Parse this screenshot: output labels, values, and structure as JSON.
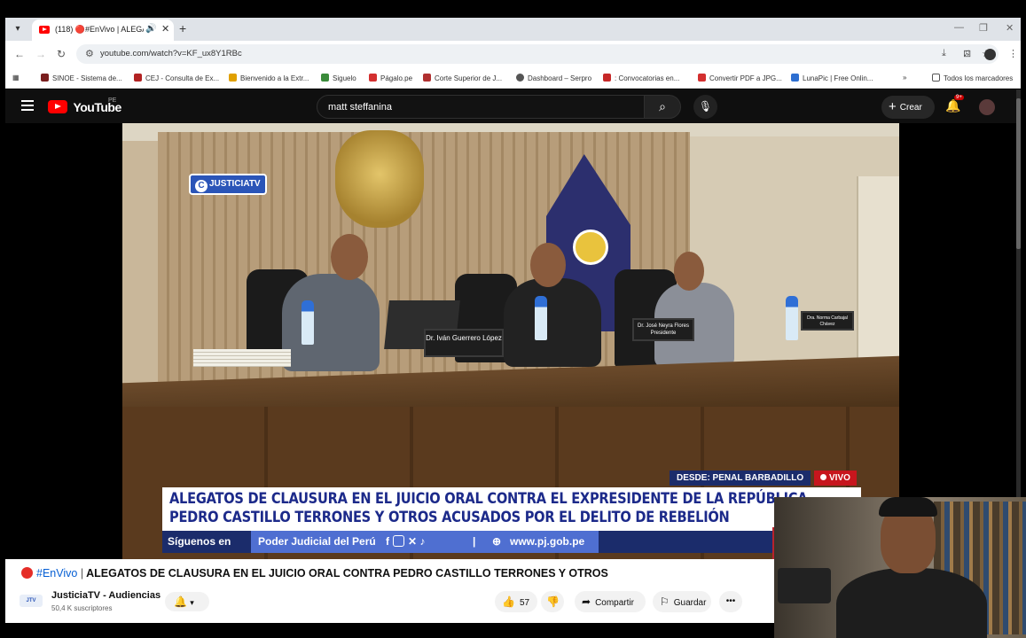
{
  "browser": {
    "tab_title": "(118) 🔴#EnVivo | ALEGATO",
    "url": "youtube.com/watch?v=KF_ux8Y1RBc",
    "bookmarks": [
      {
        "label": "SINOE - Sistema de...",
        "color": "#7a1f1f"
      },
      {
        "label": "CEJ - Consulta de Ex...",
        "color": "#b22222"
      },
      {
        "label": "Bienvenido a la Extr...",
        "color": "#e0a000"
      },
      {
        "label": "Siguelo",
        "color": "#3b8b3b"
      },
      {
        "label": "Págalo.pe",
        "color": "#d32f2f"
      },
      {
        "label": "Corte Superior de J...",
        "color": "#b03030"
      },
      {
        "label": "Dashboard – Serpro",
        "color": "#555555"
      },
      {
        "label": ": Convocatorias en...",
        "color": "#c62828"
      },
      {
        "label": "Convertir PDF a JPG...",
        "color": "#d32f2f"
      },
      {
        "label": "LunaPic | Free Onlin...",
        "color": "#2e6fd1"
      }
    ],
    "all_bookmarks": "Todos los marcadores"
  },
  "youtube": {
    "logo_text": "YouTube",
    "region": "PE",
    "search_value": "matt steffanina",
    "create_label": "Crear",
    "notif_badge": "9+"
  },
  "video": {
    "channel_bug": "JUSTICIATV",
    "nameplates": [
      "Dr. Iván Guerrero López",
      "Dr. José Neyra Flores Presidente",
      "Dra. Norma Carbajal Chávez"
    ],
    "desde": "DESDE: PENAL BARBADILLO",
    "vivo": "VIVO",
    "headline_1": "ALEGATOS DE CLAUSURA EN EL JUICIO ORAL CONTRA EL EXPRESIDENTE DE LA REPÚBLICA",
    "headline_2": "PEDRO CASTILLO TERRONES Y OTROS ACUSADOS POR EL DELITO DE REBELIÓN",
    "siguenos": "Síguenos en",
    "poder_judicial": "Poder Judicial del Perú",
    "site": "www.pj.gob.pe"
  },
  "watch": {
    "title_tag": "#EnVivo",
    "title_sep": "|",
    "title_text": "ALEGATOS DE CLAUSURA EN EL JUICIO ORAL CONTRA PEDRO CASTILLO TERRONES Y OTROS",
    "channel_name": "JusticiaTV - Audiencias",
    "subscribers": "50,4 K suscriptores",
    "likes": "57",
    "share_label": "Compartir",
    "save_label": "Guardar"
  }
}
